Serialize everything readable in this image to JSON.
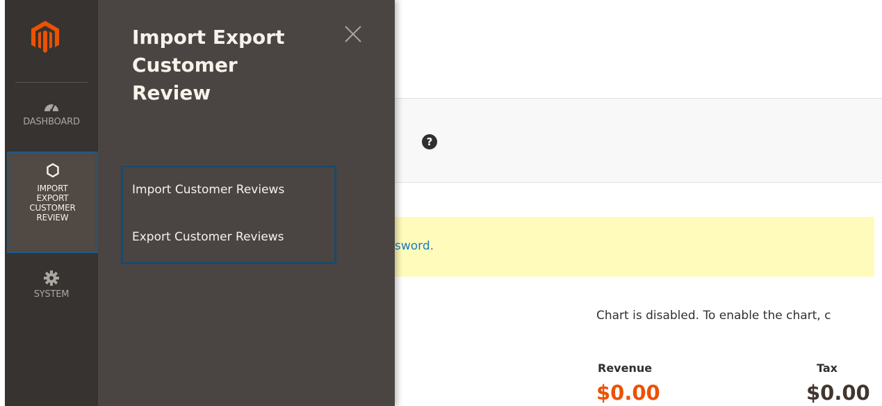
{
  "sidebar": {
    "logo_icon": "magento-logo-icon",
    "items": [
      {
        "label": "DASHBOARD",
        "icon": "dashboard-gauge-icon"
      },
      {
        "label": "IMPORT\nEXPORT\nCUSTOMER\nREVIEW",
        "icon": "hexagon-icon",
        "active": true
      },
      {
        "label": "SYSTEM",
        "icon": "gear-icon"
      }
    ]
  },
  "flyout": {
    "title": "Import Export Customer Review",
    "close_icon": "close-icon",
    "items": [
      {
        "label": "Import Customer Reviews"
      },
      {
        "label": "Export Customer Reviews"
      }
    ]
  },
  "main": {
    "help_icon": "question-circle-icon",
    "notice_text": "sword.",
    "chart_message": "Chart is disabled. To enable the chart, c",
    "totals": [
      {
        "label": "Revenue",
        "value": "$0.00"
      },
      {
        "label": "Tax",
        "value": "$0.00"
      }
    ]
  },
  "colors": {
    "sidebar_bg": "#373330",
    "flyout_bg": "#4a4542",
    "active_border": "#1e5a8c",
    "brand_orange": "#eb5202",
    "notice_bg": "#fffbbb",
    "link_blue": "#1979c3"
  }
}
